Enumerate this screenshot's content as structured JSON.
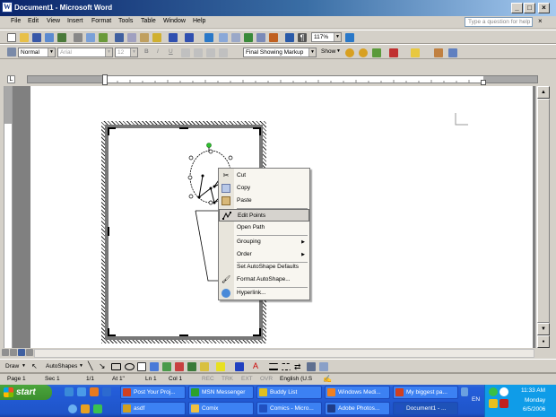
{
  "window": {
    "title": "Document1 - Microsoft Word",
    "icon": "word-doc-icon"
  },
  "menu": {
    "items": [
      "File",
      "Edit",
      "View",
      "Insert",
      "Format",
      "Tools",
      "Table",
      "Window",
      "Help"
    ],
    "help_placeholder": "Type a question for help"
  },
  "standard_toolbar": {
    "zoom": "117%"
  },
  "formatting_toolbar": {
    "style": "Normal",
    "font": "Arial",
    "size": "12",
    "markup": "Final Showing Markup",
    "show": "Show"
  },
  "context_menu": {
    "items": [
      {
        "label": "Cut",
        "icon": "scissors-icon",
        "separator_after": false
      },
      {
        "label": "Copy",
        "icon": "copy-icon",
        "separator_after": false
      },
      {
        "label": "Paste",
        "icon": "paste-icon",
        "separator_after": true
      },
      {
        "label": "Edit Points",
        "icon": "edit-points-icon",
        "highlighted": true,
        "separator_after": false
      },
      {
        "label": "Open Path",
        "icon": "",
        "separator_after": true
      },
      {
        "label": "Grouping",
        "icon": "",
        "submenu": true,
        "separator_after": false
      },
      {
        "label": "Order",
        "icon": "",
        "submenu": true,
        "separator_after": true
      },
      {
        "label": "Set AutoShape Defaults",
        "icon": "",
        "separator_after": false
      },
      {
        "label": "Format AutoShape...",
        "icon": "format-autoshape-icon",
        "separator_after": true
      },
      {
        "label": "Hyperlink...",
        "icon": "hyperlink-icon",
        "separator_after": false
      }
    ]
  },
  "draw_toolbar": {
    "draw": "Draw",
    "autoshapes": "AutoShapes"
  },
  "status": {
    "page": "Page 1",
    "sec": "Sec 1",
    "pages": "1/1",
    "at": "At 1\"",
    "ln": "Ln 1",
    "col": "Col 1",
    "rec": "REC",
    "trk": "TRK",
    "ext": "EXT",
    "ovr": "OVR",
    "lang": "English (U.S"
  },
  "taskbar": {
    "start": "start",
    "tasks_row1": [
      {
        "label": "Post Your Proj...",
        "color": "#d04020"
      },
      {
        "label": "MSN Messenger",
        "color": "#2ca02c"
      },
      {
        "label": "Buddy List",
        "color": "#e0c020"
      },
      {
        "label": "Windows Medi...",
        "color": "#f08020"
      },
      {
        "label": "My biggest pa...",
        "color": "#d04020"
      }
    ],
    "tasks_row2": [
      {
        "label": "asdf",
        "color": "#d0a020"
      },
      {
        "label": "Comix",
        "color": "#f0c040"
      },
      {
        "label": "Comics - Micro...",
        "color": "#2050c0"
      },
      {
        "label": "Adobe Photos...",
        "color": "#1f3c88"
      },
      {
        "label": "Document1 - ...",
        "color": "#2050c0",
        "active": true
      }
    ],
    "lang": "EN",
    "time": "11:33 AM",
    "day": "Monday",
    "date": "6/5/2006"
  }
}
